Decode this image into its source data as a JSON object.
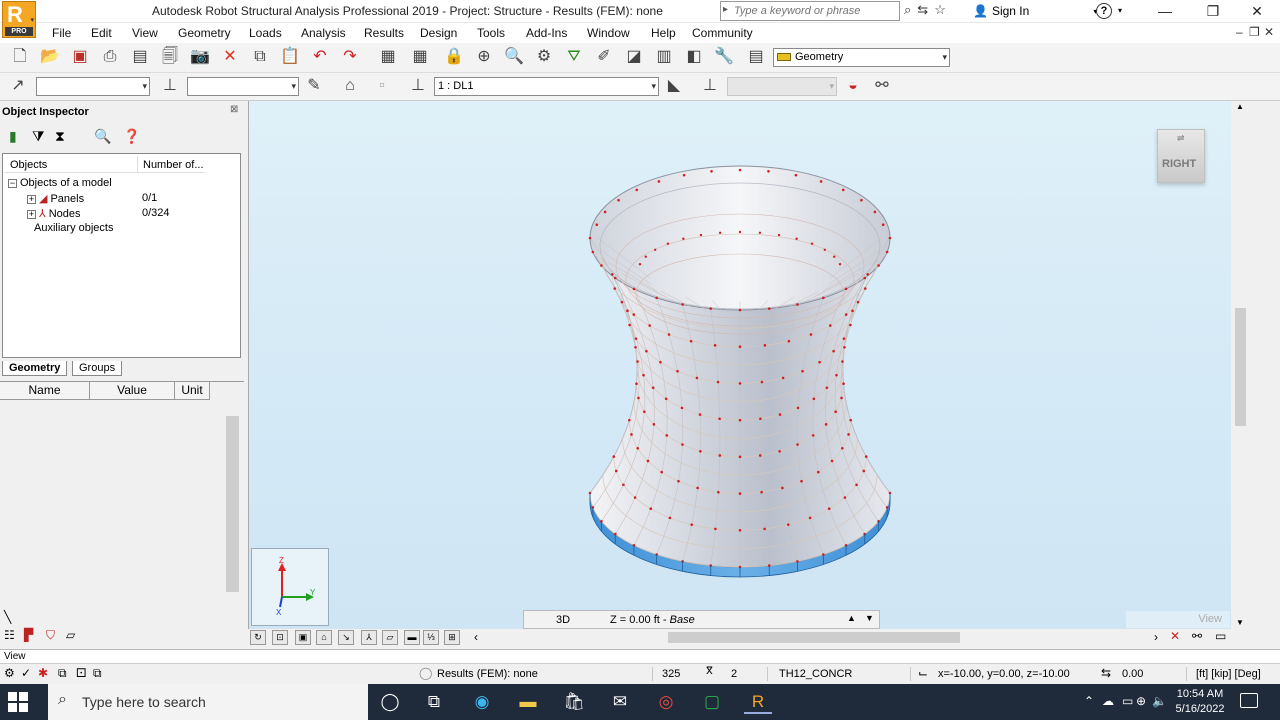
{
  "window": {
    "title": "Autodesk Robot Structural Analysis Professional 2019 - Project: Structure - Results (FEM): none",
    "logo_text": "R",
    "logo_badge": "PRO",
    "search_placeholder": "Type a keyword or phrase",
    "sign_in": "Sign In",
    "help": "?"
  },
  "menu": {
    "items": [
      "File",
      "Edit",
      "View",
      "Geometry",
      "Loads",
      "Analysis",
      "Results",
      "Design",
      "Tools",
      "Add-Ins",
      "Window",
      "Help",
      "Community"
    ]
  },
  "toolbar": {
    "layout_combo": "Geometry",
    "case_combo": "1 : DL1"
  },
  "inspector": {
    "title": "Object Inspector",
    "col_objects": "Objects",
    "col_number": "Number of...",
    "tree": [
      {
        "label": "Objects of a model",
        "count": ""
      },
      {
        "label": "Panels",
        "count": "0/1"
      },
      {
        "label": "Nodes",
        "count": "0/324"
      },
      {
        "label": "Auxiliary objects",
        "count": ""
      }
    ],
    "tabs": [
      "Geometry",
      "Groups"
    ],
    "props_headers": [
      "Name",
      "Value",
      "Unit"
    ]
  },
  "view": {
    "cube_label": "RIGHT",
    "mode": "3D",
    "level_prefix": "Z = 0.00 ft - ",
    "level_name": "Base",
    "tag": "View",
    "axis_z": "Z",
    "axis_y": "Y",
    "axis_x": "X"
  },
  "status": {
    "view_label": "View",
    "results": "Results (FEM): none",
    "node_count": "325",
    "value2": "2",
    "section": "TH12_CONCR",
    "coords": "x=-10.00, y=0.00, z=-10.00",
    "angle": "0.00",
    "units": "[ft] [kip] [Deg]"
  },
  "taskbar": {
    "search_placeholder": "Type here to search",
    "time": "10:54 AM",
    "date": "5/16/2022"
  }
}
